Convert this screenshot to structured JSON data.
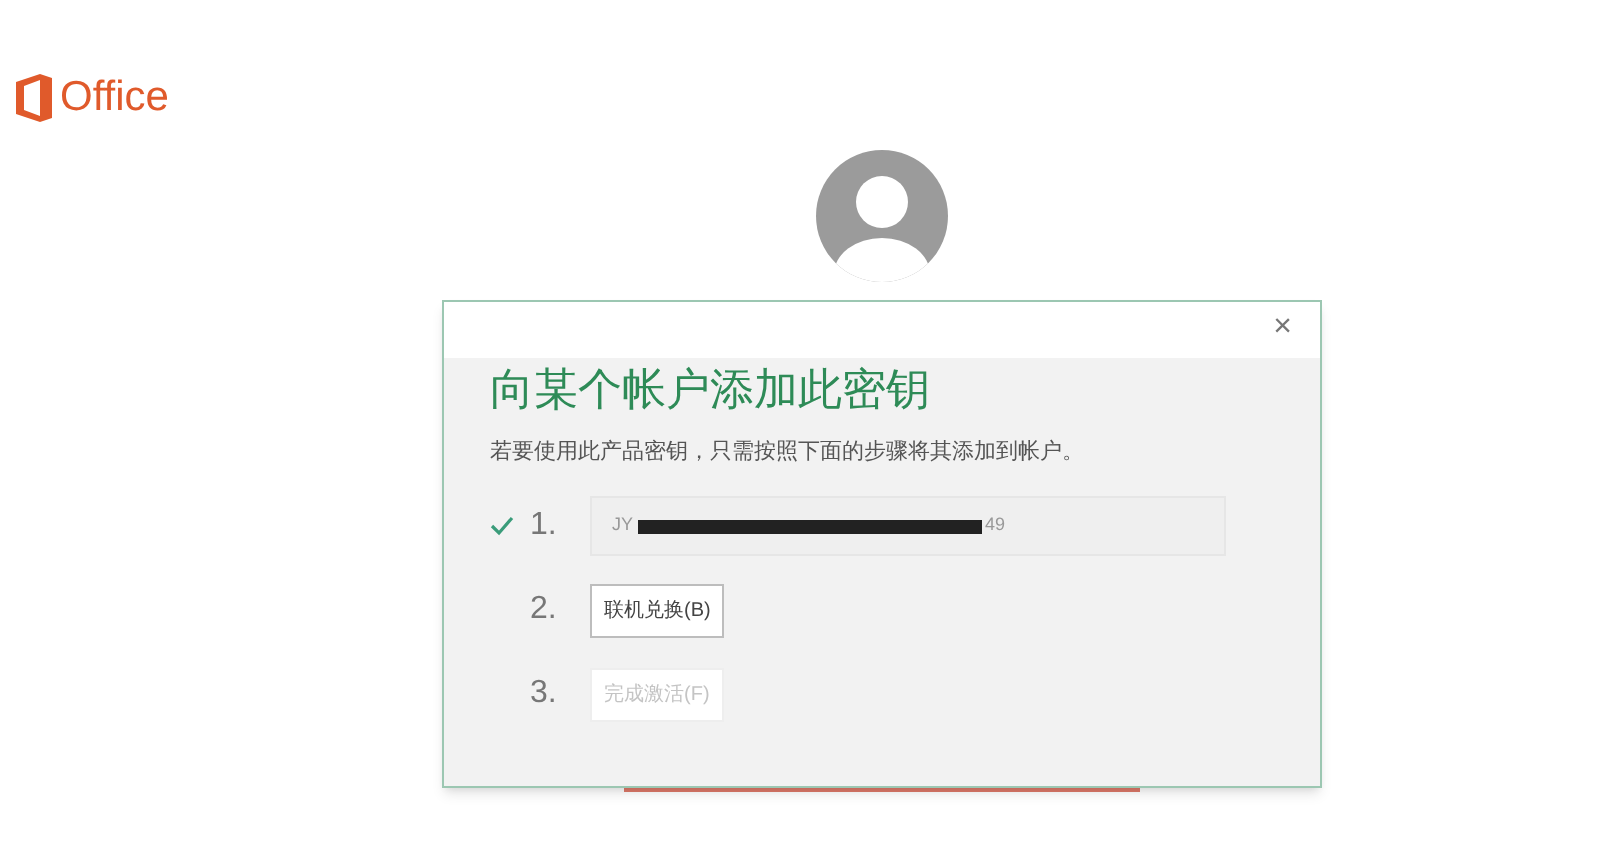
{
  "brand": {
    "name": "Office"
  },
  "dialog": {
    "close": "×",
    "title": "向某个帐户添加此密钥",
    "description": "若要使用此产品密钥，只需按照下面的步骤将其添加到帐户。",
    "steps": [
      {
        "kind": "key",
        "number": "1.",
        "done": true,
        "key_start": "JY",
        "key_end": "49"
      },
      {
        "kind": "button",
        "number": "2.",
        "done": false,
        "label": "联机兑换(B)",
        "disabled": false
      },
      {
        "kind": "button",
        "number": "3.",
        "done": false,
        "label": "完成激活(F)",
        "disabled": true
      }
    ]
  }
}
